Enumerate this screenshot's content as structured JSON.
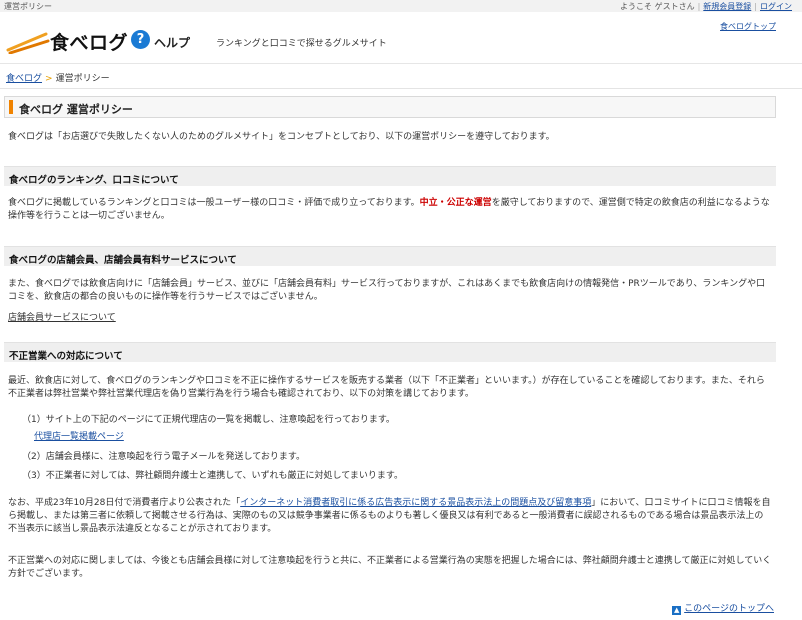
{
  "topbar": {
    "site_label": "運営ポリシー",
    "welcome": "ようこそ ゲストさん",
    "register": "新規会員登録",
    "login": "ログイン"
  },
  "header": {
    "logo_text": "食べログ",
    "help_badge": "?",
    "help_text": "ヘルプ",
    "tagline": "ランキングと口コミで探せるグルメサイト",
    "top_link": "食べログトップ"
  },
  "breadcrumb": {
    "home": "食べログ",
    "current": "運営ポリシー"
  },
  "page_title": "食べログ 運営ポリシー",
  "intro": "食べログは「お店選びで失敗したくない人のためのグルメサイト」をコンセプトとしており、以下の運営ポリシーを遵守しております。",
  "sections": {
    "ranking": {
      "heading": "食べログのランキング、口コミについて",
      "text_a": "食べログに掲載しているランキングと口コミは一般ユーザー様の口コミ・評価で成り立っております。",
      "text_red": "中立・公正な運営",
      "text_b": "を厳守しておりますので、運営側で特定の飲食店の利益になるような操作等を行うことは一切ございません。"
    },
    "store": {
      "heading": "食べログの店舗会員、店舗会員有料サービスについて",
      "text": "また、食べログでは飲食店向けに「店舗会員」サービス、並びに「店舗会員有料」サービス行っておりますが、これはあくまでも飲食店向けの情報発信・PRツールであり、ランキングや口コミを、飲食店の都合の良いものに操作等を行うサービスではございません。",
      "link": "店舗会員サービスについて"
    },
    "fraud": {
      "heading": "不正営業への対応について",
      "text": "最近、飲食店に対して、食べログのランキングや口コミを不正に操作するサービスを販売する業者（以下「不正業者」といいます。）が存在していることを確認しております。また、それら不正業者は弊社営業や弊社営業代理店を偽り営業行為を行う場合も確認されており、以下の対策を講じております。",
      "items": [
        "（1）サイト上の下記のページにて正規代理店の一覧を掲載し、注意喚起を行っております。",
        "（2）店舗会員様に、注意喚起を行う電子メールを発送しております。",
        "（3）不正業者に対しては、弊社顧問弁護士と連携して、いずれも厳正に対処してまいります。"
      ],
      "agency_link": "代理店一覧掲載ページ",
      "note_a": "なお、平成23年10月28日付で消費者庁より公表された「",
      "note_link": "インターネット消費者取引に係る広告表示に関する景品表示法上の問題点及び留意事項",
      "note_b": "」において、口コミサイトに口コミ情報を自ら掲載し、または第三者に依頼して掲載させる行為は、実際のもの又は競争事業者に係るものよりも著しく優良又は有利であると一般消費者に誤認されるものである場合は景品表示法上の不当表示に該当し景品表示法違反となることが示されております。",
      "closing": "不正営業への対応に関しましては、今後とも店舗会員様に対して注意喚起を行うと共に、不正業者による営業行為の実態を把握した場合には、弊社顧問弁護士と連携して厳正に対処していく方針でございます。"
    }
  },
  "page_top": "このページのトップへ",
  "colors": {
    "link": "#1a4fa0",
    "accent": "#f08300",
    "warning": "#cc0000",
    "help_badge": "#1a7ad4"
  }
}
